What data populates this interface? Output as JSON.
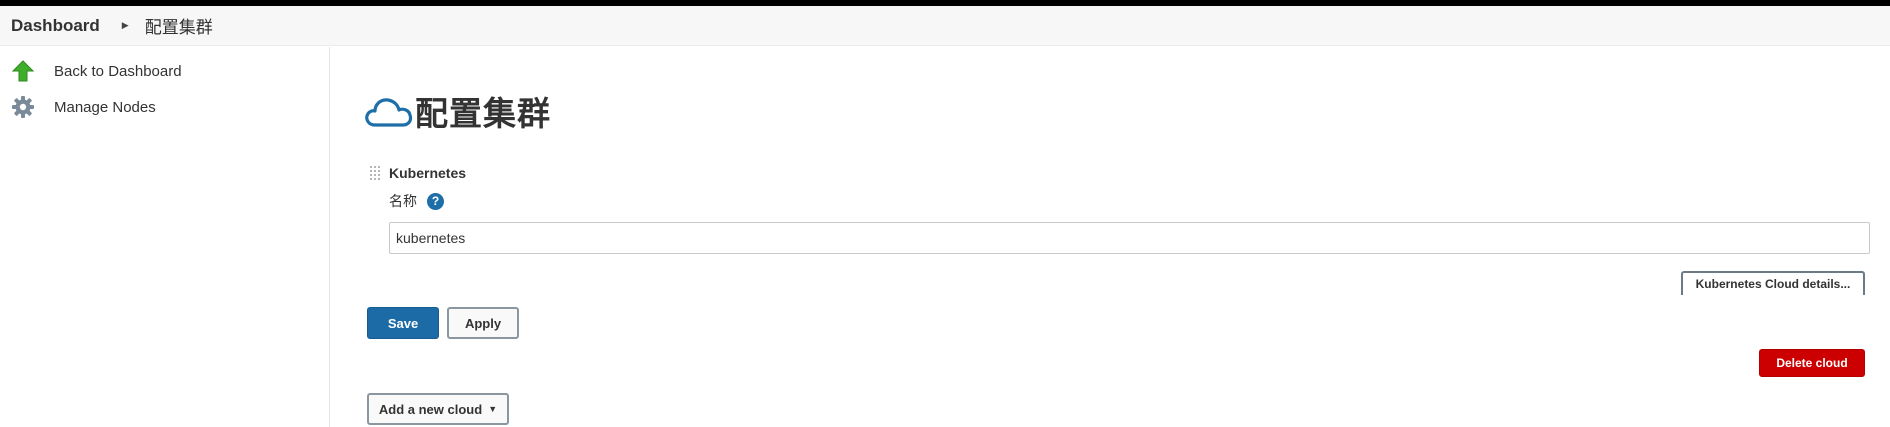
{
  "breadcrumb": {
    "home": "Dashboard",
    "separator_icon": "triangle-right-icon",
    "current": "配置集群"
  },
  "sidebar": {
    "items": [
      {
        "label": "Back to Dashboard",
        "icon": "up-arrow-icon"
      },
      {
        "label": "Manage Nodes",
        "icon": "gear-icon"
      }
    ]
  },
  "main": {
    "title": "配置集群",
    "title_icon": "cloud-icon",
    "section": {
      "header": "Kubernetes",
      "name_label": "名称",
      "help_symbol": "?",
      "name_value": "kubernetes",
      "details_button": "Kubernetes Cloud details...",
      "delete_button": "Delete cloud"
    },
    "actions": {
      "save": "Save",
      "apply": "Apply",
      "add_cloud": "Add a new cloud",
      "add_cloud_caret": "▼"
    }
  },
  "colors": {
    "primary_button": "#1c6ba6",
    "danger_button": "#cc0000",
    "help_icon": "#1e6fa8",
    "cloud_icon": "#1e6fa8",
    "arrow_icon": "#3fae2a"
  }
}
